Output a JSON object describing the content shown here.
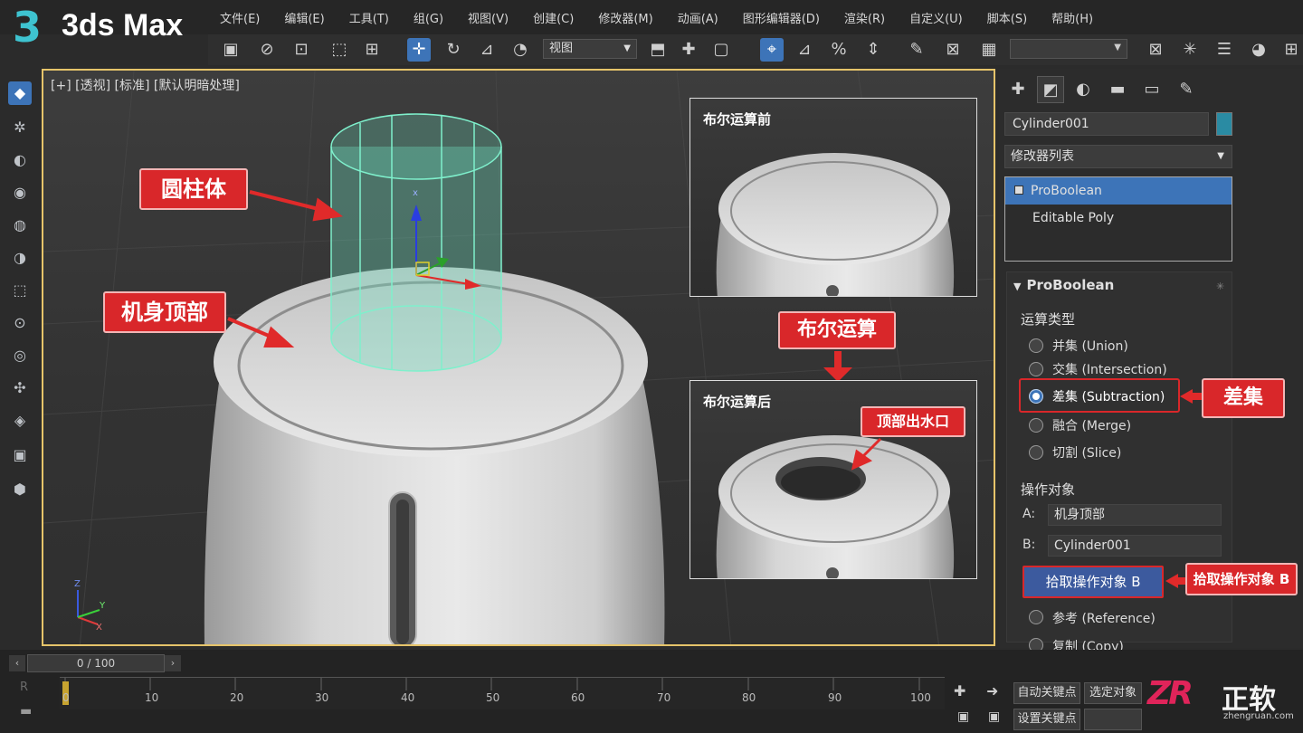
{
  "app": {
    "logo_number": "3",
    "logo_text": "3ds Max"
  },
  "menu": [
    "文件(E)",
    "编辑(E)",
    "工具(T)",
    "组(G)",
    "视图(V)",
    "创建(C)",
    "修改器(M)",
    "动画(A)",
    "图形编辑器(D)",
    "渲染(R)",
    "自定义(U)",
    "脚本(S)",
    "帮助(H)"
  ],
  "toolbar": {
    "view_dropdown": "视图"
  },
  "viewport": {
    "label": "[+] [透视] [标准] [默认明暗处理]",
    "axis_z": "Z",
    "axis_x": "X",
    "axis_y": "Y",
    "gizmo_x": "x",
    "callouts": {
      "cylinder": "圆柱体",
      "body_top": "机身顶部",
      "boolean": "布尔运算",
      "outlet": "顶部出水口"
    },
    "inset_before_title": "布尔运算前",
    "inset_after_title": "布尔运算后"
  },
  "panel": {
    "object_name": "Cylinder001",
    "object_color": "#2a8ba3",
    "modifier_list": "修改器列表",
    "stack": [
      "ProBoolean",
      "Editable Poly"
    ],
    "rollout_title": "ProBoolean",
    "op_type_label": "运算类型",
    "op_types": [
      "并集 (Union)",
      "交集 (Intersection)",
      "差集 (Subtraction)",
      "融合 (Merge)",
      "切割 (Slice)"
    ],
    "operands_label": "操作对象",
    "operand_a_label": "A:",
    "operand_a": "机身顶部",
    "operand_b_label": "B:",
    "operand_b": "Cylinder001",
    "pick_button": "拾取操作对象 B",
    "copy_modes": [
      "参考 (Reference)",
      "复制 (Copy)"
    ],
    "callout_subtraction": "差集",
    "callout_pick": "拾取操作对象 B"
  },
  "timeline": {
    "frame_display": "0 / 100",
    "ticks": [
      "0",
      "10",
      "20",
      "30",
      "40",
      "50",
      "60",
      "70",
      "80",
      "90",
      "100"
    ],
    "auto_key": "自动关键点",
    "set_key": "设置关键点",
    "selected_object": "选定对象"
  },
  "watermark": {
    "logo": "ZR",
    "name": "正软",
    "site": "zhengruan.com"
  },
  "colors": {
    "accent": "#3d74b8",
    "callout_red": "#d9272a",
    "viewport_border": "#e6c46a",
    "cylinder": "#6fe0c0"
  }
}
